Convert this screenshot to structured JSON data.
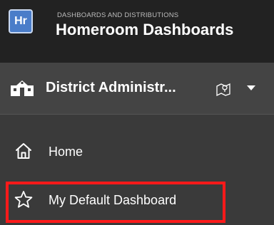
{
  "header": {
    "logo_text": "Hr",
    "supertitle": "DASHBOARDS AND DISTRIBUTIONS",
    "title": "Homeroom Dashboards"
  },
  "district": {
    "icon": "school-building-icon",
    "label": "District Administr...",
    "map_icon": "map-pin-icon",
    "dropdown_icon": "caret-down-icon"
  },
  "nav": {
    "items": [
      {
        "icon": "home-icon",
        "label": "Home"
      },
      {
        "icon": "star-outline-icon",
        "label": "My Default Dashboard"
      }
    ]
  },
  "colors": {
    "header_bg": "#222222",
    "panel_bg": "#3a3a3a",
    "district_bg": "#444444",
    "logo_blue": "#4a7dc9",
    "highlight": "#ff1a1a"
  }
}
